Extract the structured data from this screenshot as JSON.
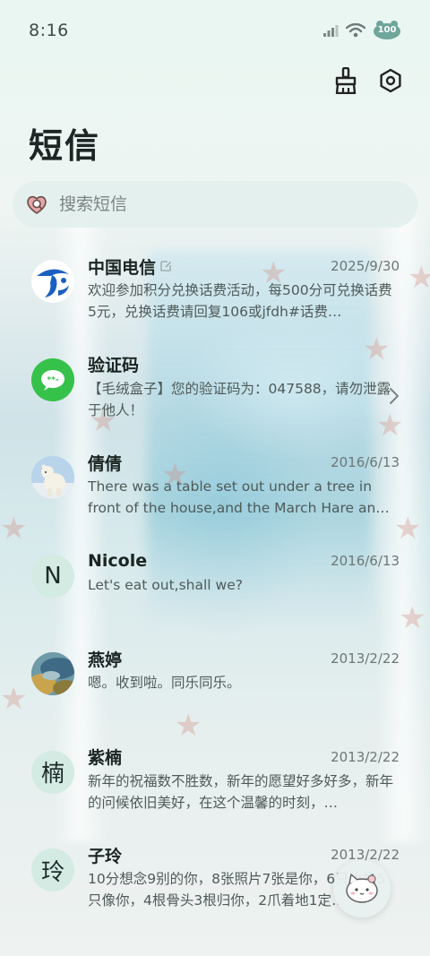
{
  "status": {
    "time": "8:16",
    "battery": "100"
  },
  "header": {
    "title": "短信"
  },
  "search": {
    "placeholder": "搜索短信"
  },
  "messages": [
    {
      "name": "中国电信",
      "date": "2025/9/30",
      "preview": "欢迎参加积分兑换话费活动，每500分可兑换话费5元，兑换话费请回复106或jfdh#话费…",
      "avatar": "china-telecom-logo"
    },
    {
      "name": "验证码",
      "date": "",
      "preview": "【毛绒盒子】您的验证码为：047588，请勿泄露于他人！",
      "avatar": "message-app-icon"
    },
    {
      "name": "倩倩",
      "date": "2016/6/13",
      "preview": "There was a table set out under a tree in front of the house,and the March Hare an…",
      "avatar": "polar-bear-photo"
    },
    {
      "name": "Nicole",
      "date": "2016/6/13",
      "preview": "Let's eat out,shall we?",
      "avatar_letter": "N"
    },
    {
      "name": "燕婷",
      "date": "2013/2/22",
      "preview": "嗯。收到啦。同乐同乐。",
      "avatar": "landscape-photo"
    },
    {
      "name": "紫楠",
      "date": "2013/2/22",
      "preview": "新年的祝福数不胜数，新年的愿望好多好多，新年的问候依旧美好，在这个温馨的时刻，…",
      "avatar_letter": "楠"
    },
    {
      "name": "子玲",
      "date": "2013/2/22",
      "preview": "10分想念9别的你，8张照片7张是你，6只小狗5只像你，4根骨头3根归你，2爪着地1定…",
      "avatar_letter": "玲"
    }
  ],
  "colors": {
    "accent": "#36c24a",
    "telecom_blue": "#1a5ec2",
    "letter_avatar_bg": "#d3ebe3"
  }
}
